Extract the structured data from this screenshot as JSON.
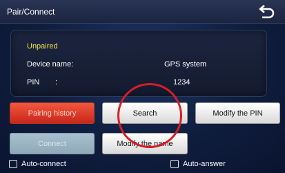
{
  "titlebar": {
    "title": "Pair/Connect",
    "back_icon": "back-arrow-icon"
  },
  "device": {
    "status": "Unpaired",
    "name_label": "Device name:",
    "name_value": "GPS system",
    "pin_label": "PIN",
    "pin_sep": ":",
    "pin_value": "1234"
  },
  "buttons": {
    "pairing_history": "Pairing history",
    "search": "Search",
    "modify_pin": "Modify the PIN",
    "connect": "Connect",
    "modify_name": "Modify the name"
  },
  "options": {
    "auto_connect": "Auto-connect",
    "auto_answer": "Auto-answer"
  },
  "colors": {
    "status": "#f5e34a",
    "accent_red": "#d61e26",
    "background": "#0f1d3c"
  }
}
